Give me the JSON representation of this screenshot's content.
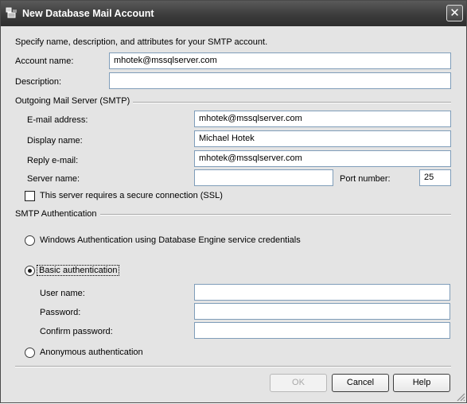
{
  "window": {
    "title": "New Database Mail Account",
    "icons": {
      "app": "database-mail-icon",
      "close": "close-icon"
    },
    "close_glyph": "✕"
  },
  "intro": "Specify name, description, and attributes for your SMTP account.",
  "account": {
    "name_label": "Account name:",
    "name_value": "mhotek@mssqlserver.com",
    "description_label": "Description:",
    "description_value": ""
  },
  "smtp": {
    "group_label": "Outgoing Mail Server (SMTP)",
    "email_label": "E-mail address:",
    "email_value": "mhotek@mssqlserver.com",
    "display_label": "Display name:",
    "display_value": "Michael Hotek",
    "reply_label": "Reply e-mail:",
    "reply_value": "mhotek@mssqlserver.com",
    "server_label": "Server name:",
    "server_value": "",
    "port_label": "Port number:",
    "port_value": "25",
    "ssl_label": "This server requires a secure connection (SSL)",
    "ssl_checked": false
  },
  "auth": {
    "group_label": "SMTP Authentication",
    "windows_label": "Windows Authentication using Database Engine service credentials",
    "basic_label": "Basic authentication",
    "selected": "basic",
    "username_label": "User name:",
    "username_value": "",
    "password_label": "Password:",
    "password_value": "",
    "confirm_label": "Confirm password:",
    "confirm_value": "",
    "anonymous_label": "Anonymous authentication"
  },
  "buttons": {
    "ok": "OK",
    "cancel": "Cancel",
    "help": "Help"
  },
  "colors": {
    "titlebar": "#3c3c3c",
    "dialog_bg": "#e4e4e4",
    "field_border": "#7f9db9"
  }
}
